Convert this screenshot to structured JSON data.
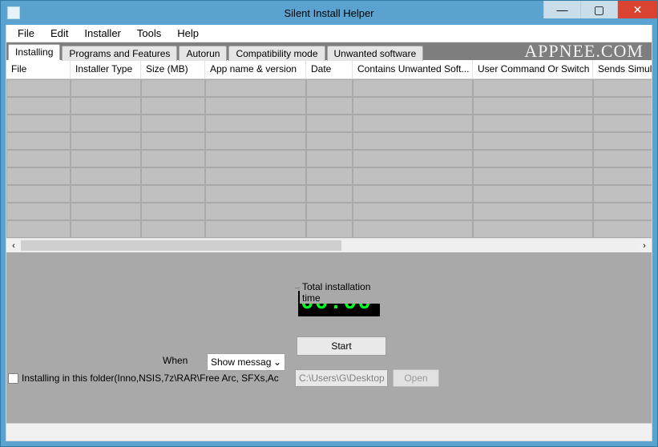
{
  "window": {
    "title": "Silent Install Helper",
    "watermark": "APPNEE.COM"
  },
  "menu": {
    "items": [
      "File",
      "Edit",
      "Installer",
      "Tools",
      "Help"
    ]
  },
  "tabs": {
    "items": [
      "Installing",
      "Programs and Features",
      "Autorun",
      "Compatibility mode",
      "Unwanted software"
    ],
    "active_index": 0
  },
  "table": {
    "columns": [
      {
        "label": "File",
        "width": 80
      },
      {
        "label": "Installer Type",
        "width": 88
      },
      {
        "label": "Size (MB)",
        "width": 80
      },
      {
        "label": "App name & version",
        "width": 126
      },
      {
        "label": "Date",
        "width": 58
      },
      {
        "label": "Contains Unwanted Soft...",
        "width": 150
      },
      {
        "label": "User Command Or Switch",
        "width": 150
      },
      {
        "label": "Sends Simula",
        "width": 90
      }
    ],
    "row_count": 9
  },
  "timer": {
    "group_label": "Total installation time",
    "value": "00:00"
  },
  "controls": {
    "start_label": "Start",
    "when_label": "When",
    "when_selected": "Show messag",
    "checkbox_label": "Installing in this folder(Inno,NSIS,7z\\RAR\\Free Arc, SFXs,Ac",
    "path_value": "C:\\Users\\G\\Desktop",
    "open_label": "Open"
  },
  "icons": {
    "minimize": "—",
    "maximize": "▢",
    "close": "✕",
    "left": "‹",
    "right": "›",
    "caret": "⌄"
  }
}
